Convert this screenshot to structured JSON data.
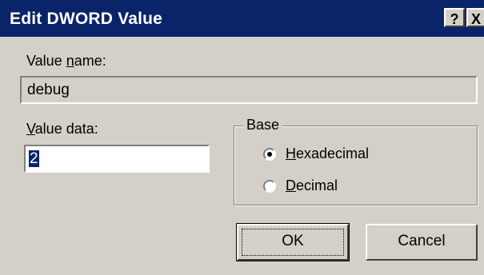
{
  "window": {
    "title": "Edit DWORD Value",
    "help_glyph": "?",
    "close_glyph": "X"
  },
  "value_name": {
    "label_prefix": "Value ",
    "label_underline": "n",
    "label_suffix": "ame:",
    "value": "debug"
  },
  "value_data": {
    "label_underline": "V",
    "label_suffix": "alue data:",
    "value": "2"
  },
  "base": {
    "legend": "Base",
    "options": [
      {
        "underline": "H",
        "rest": "exadecimal",
        "selected": true
      },
      {
        "underline": "D",
        "rest": "ecimal",
        "selected": false
      }
    ]
  },
  "buttons": {
    "ok": "OK",
    "cancel": "Cancel"
  },
  "colors": {
    "titlebar": "#0a246a",
    "face": "#d4d0c8",
    "selection": "#0a246a"
  }
}
